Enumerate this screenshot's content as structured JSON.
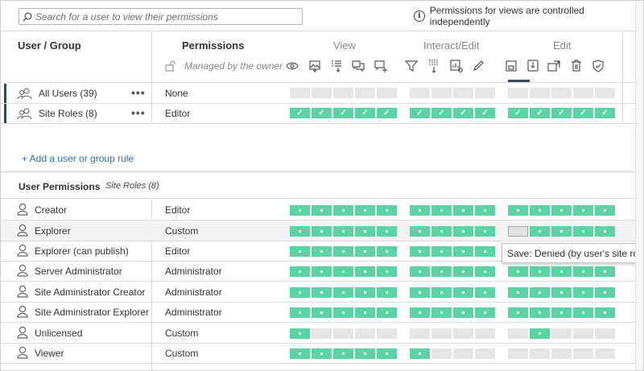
{
  "search": {
    "placeholder": "Search for a user to view their permissions"
  },
  "info": {
    "text": "Permissions for views are controlled independently"
  },
  "header": {
    "user_group": "User / Group",
    "permissions": "Permissions",
    "managed_by_owner": "Managed by the owner",
    "groups": [
      "View",
      "Interact/Edit",
      "Edit"
    ]
  },
  "capabilities": [
    {
      "icon": "view-icon"
    },
    {
      "icon": "download-image-icon"
    },
    {
      "icon": "download-summary-data-icon"
    },
    {
      "icon": "view-comments-icon"
    },
    {
      "icon": "add-comment-icon"
    },
    {
      "icon": "filter-icon"
    },
    {
      "icon": "download-full-data-icon"
    },
    {
      "icon": "share-customized-icon"
    },
    {
      "icon": "web-edit-icon"
    },
    {
      "icon": "save-icon"
    },
    {
      "icon": "download-workbook-icon"
    },
    {
      "icon": "move-icon"
    },
    {
      "icon": "delete-icon"
    },
    {
      "icon": "set-permissions-icon"
    }
  ],
  "rules": [
    {
      "name": "All Users (39)",
      "role": "None",
      "more": "•••",
      "cells": [
        "n",
        "n",
        "n",
        "n",
        "n",
        "n",
        "n",
        "n",
        "n",
        "n",
        "n",
        "n",
        "n",
        "n"
      ]
    },
    {
      "name": "Site Roles (8)",
      "role": "Editor",
      "more": "•••",
      "cells": [
        "c",
        "c",
        "c",
        "c",
        "c",
        "c",
        "c",
        "c",
        "c",
        "c",
        "c",
        "c",
        "c",
        "c"
      ]
    }
  ],
  "add_rule": "+ Add a user or group rule",
  "user_permissions": {
    "title": "User Permissions",
    "subtitle": "Site Roles (8)"
  },
  "users": [
    {
      "name": "Creator",
      "role": "Editor",
      "cells": [
        "a",
        "a",
        "a",
        "a",
        "a",
        "a",
        "a",
        "a",
        "a",
        "a",
        "a",
        "a",
        "a",
        "a"
      ]
    },
    {
      "name": "Explorer",
      "role": "Custom",
      "cells": [
        "a",
        "a",
        "a",
        "a",
        "a",
        "a",
        "a",
        "a",
        "a",
        "d",
        "a",
        "a",
        "a",
        "a"
      ]
    },
    {
      "name": "Explorer (can publish)",
      "role": "Editor",
      "cells": [
        "a",
        "a",
        "a",
        "a",
        "a",
        "a",
        "a",
        "a",
        "a",
        "a",
        "a",
        "a",
        "a",
        "a"
      ]
    },
    {
      "name": "Server Administrator",
      "role": "Administrator",
      "cells": [
        "a",
        "a",
        "a",
        "a",
        "a",
        "a",
        "a",
        "a",
        "a",
        "a",
        "a",
        "a",
        "a",
        "a"
      ]
    },
    {
      "name": "Site Administrator Creator",
      "role": "Administrator",
      "cells": [
        "a",
        "a",
        "a",
        "a",
        "a",
        "a",
        "a",
        "a",
        "a",
        "a",
        "a",
        "a",
        "a",
        "a"
      ]
    },
    {
      "name": "Site Administrator Explorer",
      "role": "Administrator",
      "cells": [
        "a",
        "a",
        "a",
        "a",
        "a",
        "a",
        "a",
        "a",
        "a",
        "a",
        "a",
        "a",
        "a",
        "a"
      ]
    },
    {
      "name": "Unlicensed",
      "role": "Custom",
      "cells": [
        "a",
        "n",
        "n",
        "n",
        "n",
        "n",
        "n",
        "n",
        "n",
        "n",
        "a",
        "n",
        "n",
        "n"
      ]
    },
    {
      "name": "Viewer",
      "role": "Custom",
      "cells": [
        "a",
        "a",
        "a",
        "a",
        "a",
        "a",
        "n",
        "n",
        "n",
        "n",
        "n",
        "n",
        "n",
        "n"
      ]
    }
  ],
  "tooltip": "Save: Denied (by user's site role)",
  "colors": {
    "allowed": "#5bd4a4",
    "none": "#e6e6e6",
    "denied": "#e3e3e3",
    "link": "#2c6fb7",
    "selected_rule_marker": "#2e4a6a"
  }
}
